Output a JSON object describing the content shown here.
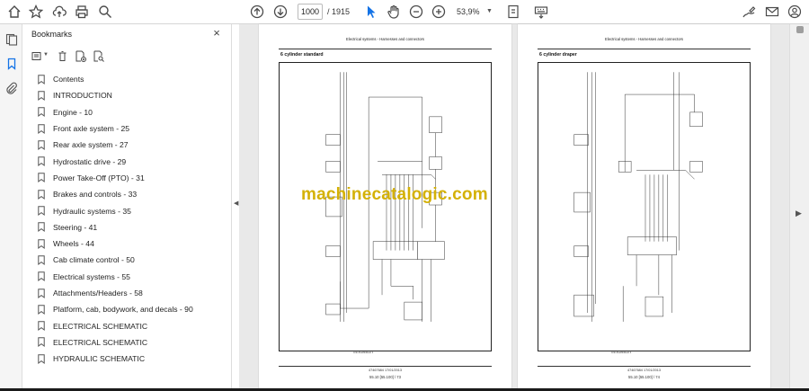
{
  "toolbar": {
    "page_current": "1000",
    "page_total": "/ 1915",
    "zoom": "53,9%",
    "left_icons": [
      "home-icon",
      "star-icon",
      "cloud-upload-icon",
      "print-icon",
      "zoom-search-icon"
    ],
    "center_icons": [
      "page-up-icon",
      "page-down-icon",
      "select-cursor-icon",
      "hand-tool-icon",
      "zoom-out-icon",
      "zoom-in-icon"
    ],
    "right_icons": [
      "fit-page-icon",
      "keyboard-icon",
      "sign-icon",
      "email-icon",
      "account-icon"
    ]
  },
  "panel": {
    "title": "Bookmarks",
    "close": "×",
    "bookmarks": [
      "Contents",
      "INTRODUCTION",
      "Engine - 10",
      "Front axle system - 25",
      "Rear axle system - 27",
      "Hydrostatic drive - 29",
      "Power Take-Off (PTO) - 31",
      "Brakes and controls - 33",
      "Hydraulic systems - 35",
      "Steering - 41",
      "Wheels - 44",
      "Cab climate control - 50",
      "Electrical systems - 55",
      "Attachments/Headers - 58",
      "Platform, cab, bodywork, and decals - 90",
      "ELECTRICAL SCHEMATIC",
      "ELECTRICAL SCHEMATIC",
      "HYDRAULIC SCHEMATIC"
    ]
  },
  "pages": [
    {
      "header": "Electrical systems - Harnesses and connectors",
      "subtitle": "6 cylinder standard",
      "mini": "Anti-Fuellinktest  1",
      "footer1": "47467684 17/01/2013",
      "footer2": "55.10 [55.100] / 73"
    },
    {
      "header": "Electrical systems - Harnesses and connectors",
      "subtitle": "6 cylinder draper",
      "mini": "Anti-Fuellinktest  2",
      "footer1": "47467684 17/01/2013",
      "footer2": "55.10 [55.100] / 74"
    }
  ],
  "watermark": "machinecatalogic.com",
  "colors": {
    "accent": "#1473e6",
    "watermark": "#d4b106"
  }
}
